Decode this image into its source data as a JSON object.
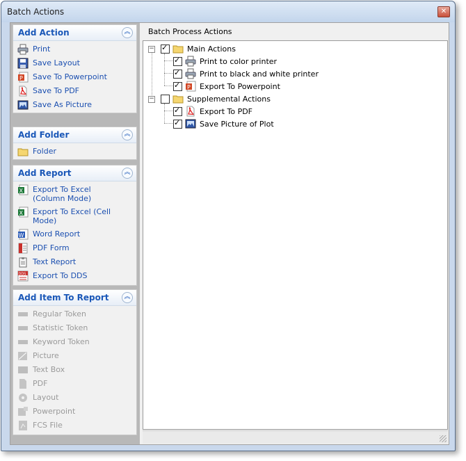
{
  "window": {
    "title": "Batch Actions"
  },
  "sidebar": {
    "add_action": {
      "title": "Add Action",
      "items": [
        {
          "label": "Print",
          "icon": "printer-icon"
        },
        {
          "label": "Save Layout",
          "icon": "floppy-disk-icon"
        },
        {
          "label": "Save To Powerpoint",
          "icon": "powerpoint-icon"
        },
        {
          "label": "Save To PDF",
          "icon": "pdf-icon"
        },
        {
          "label": "Save As Picture",
          "icon": "picture-icon"
        }
      ]
    },
    "add_folder": {
      "title": "Add Folder",
      "items": [
        {
          "label": "Folder",
          "icon": "folder-icon"
        }
      ]
    },
    "add_report": {
      "title": "Add Report",
      "items": [
        {
          "label": "Export To Excel (Column Mode)",
          "icon": "excel-icon"
        },
        {
          "label": "Export To Excel (Cell Mode)",
          "icon": "excel-icon"
        },
        {
          "label": "Word Report",
          "icon": "word-icon"
        },
        {
          "label": "PDF Form",
          "icon": "pdf-form-icon"
        },
        {
          "label": "Text Report",
          "icon": "text-report-icon"
        },
        {
          "label": "Export To DDS",
          "icon": "dds-icon"
        }
      ]
    },
    "add_item_to_report": {
      "title": "Add Item To Report",
      "items": [
        {
          "label": "Regular Token",
          "icon": "token-icon"
        },
        {
          "label": "Statistic Token",
          "icon": "token-icon"
        },
        {
          "label": "Keyword Token",
          "icon": "token-icon"
        },
        {
          "label": "Picture",
          "icon": "picture-icon"
        },
        {
          "label": "Text Box",
          "icon": "textbox-icon"
        },
        {
          "label": "PDF",
          "icon": "pdf-icon"
        },
        {
          "label": "Layout",
          "icon": "layout-icon"
        },
        {
          "label": "Powerpoint",
          "icon": "powerpoint-icon"
        },
        {
          "label": "FCS File",
          "icon": "fcs-file-icon"
        }
      ]
    }
  },
  "main": {
    "title": "Batch Process Actions",
    "tree": {
      "main_actions": {
        "label": "Main Actions",
        "checked": true,
        "children": [
          {
            "label": "Print to color printer",
            "checked": true,
            "icon": "printer-icon"
          },
          {
            "label": "Print to black and white printer",
            "checked": true,
            "icon": "printer-icon"
          },
          {
            "label": "Export To Powerpoint",
            "checked": true,
            "icon": "powerpoint-icon"
          }
        ]
      },
      "supplemental_actions": {
        "label": "Supplemental Actions",
        "checked": false,
        "children": [
          {
            "label": "Export To PDF",
            "checked": true,
            "icon": "pdf-icon"
          },
          {
            "label": "Save Picture of Plot",
            "checked": true,
            "icon": "picture-icon"
          }
        ]
      }
    }
  }
}
